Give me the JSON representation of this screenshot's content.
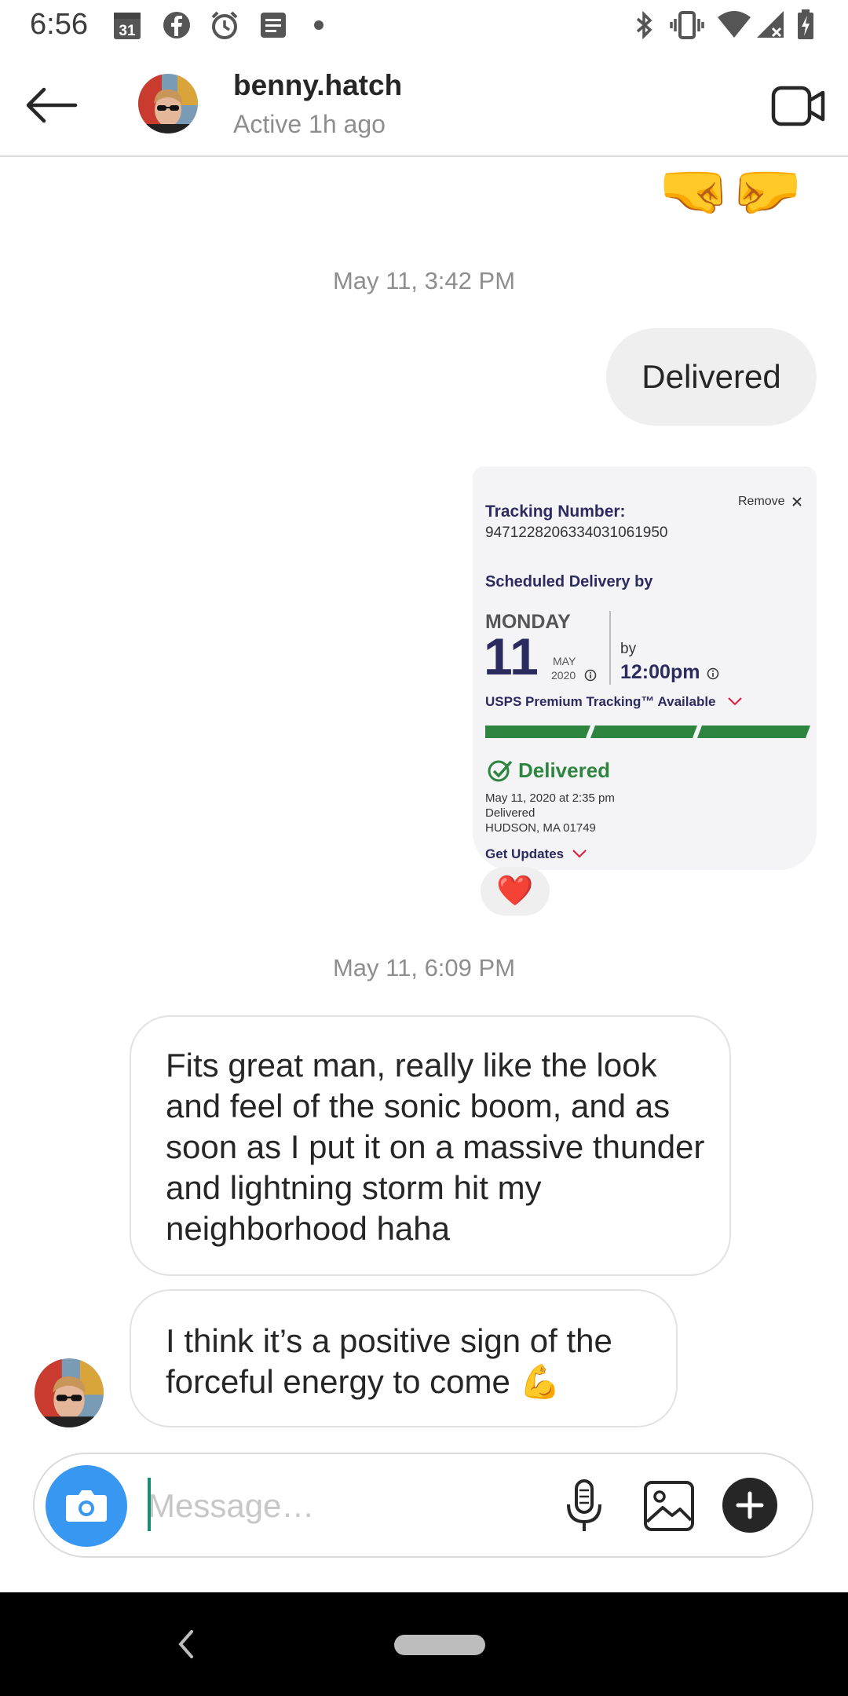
{
  "status_bar": {
    "time": "6:56",
    "calendar_day": "31",
    "icons": [
      "calendar-icon",
      "facebook-icon",
      "alarm-icon",
      "notes-icon",
      "dot-icon",
      "bluetooth-icon",
      "vibrate-icon",
      "wifi-icon",
      "signal-icon",
      "battery-icon"
    ]
  },
  "header": {
    "username": "benny.hatch",
    "activity": "Active 1h ago",
    "icons": [
      "back-arrow-icon",
      "video-call-icon"
    ]
  },
  "thread": {
    "top_emoji": "🤜🤛",
    "timestamp_1": "May 11, 3:42 PM",
    "outgoing_1": "Delivered",
    "tracking_card": {
      "remove_label": "Remove",
      "tracking_number_label": "Tracking Number:",
      "tracking_number": "9471228206334031061950",
      "scheduled_label": "Scheduled Delivery by",
      "weekday": "MONDAY",
      "day": "11",
      "month": "MAY",
      "year": "2020",
      "by_label": "by",
      "by_time": "12:00pm",
      "premium_tracking": "USPS Premium Tracking™ Available",
      "progress_segments_complete": 3,
      "progress_segments_total": 3,
      "status": "Delivered",
      "status_color": "#2e8540",
      "detail_line_1": "May 11, 2020 at 2:35 pm",
      "detail_line_2": "Delivered",
      "detail_line_3": "HUDSON, MA 01749",
      "get_updates": "Get Updates"
    },
    "reaction": "❤️",
    "timestamp_2": "May 11, 6:09 PM",
    "incoming_1": "Fits great man, really like the look and feel of the sonic boom, and as soon as I put it on a massive thunder and lightning storm hit my neighborhood haha",
    "incoming_2": "I think it’s a positive sign of the forceful energy to come 💪"
  },
  "composer": {
    "placeholder": "Message…",
    "icons": [
      "camera-icon",
      "microphone-icon",
      "gallery-icon",
      "plus-icon"
    ]
  },
  "colors": {
    "accent_blue": "#3897f0",
    "usps_navy": "#2b2b5f",
    "usps_red": "#e31837",
    "delivered_green": "#2e8540"
  }
}
